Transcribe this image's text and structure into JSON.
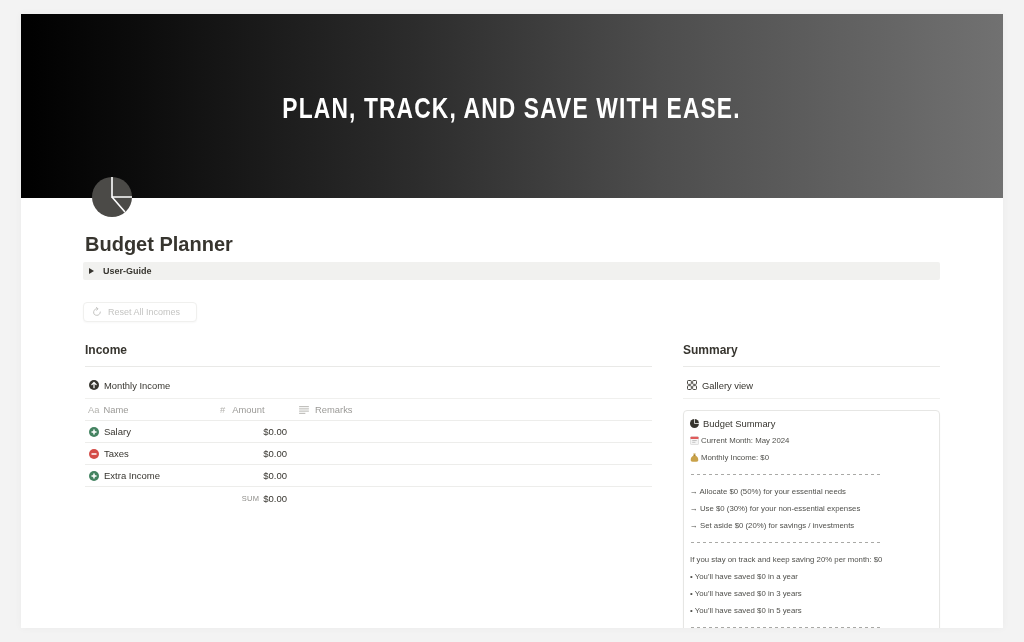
{
  "cover": {
    "headline": "PLAN, TRACK, AND SAVE WITH EASE."
  },
  "page": {
    "title": "Budget Planner"
  },
  "toggle": {
    "label": "User-Guide",
    "expanded": false
  },
  "reset_button": {
    "label": "Reset All Incomes",
    "disabled": true
  },
  "income": {
    "heading": "Income",
    "view_tab": {
      "label": "Monthly Income"
    },
    "table": {
      "columns": [
        {
          "name": "Name",
          "kind": "title",
          "glyph": "Aa"
        },
        {
          "name": "Amount",
          "kind": "number",
          "glyph": "#"
        },
        {
          "name": "Remarks",
          "kind": "text"
        }
      ],
      "rows": [
        {
          "kind": "add",
          "color": "#448361",
          "name": "Salary",
          "amount": "$0.00"
        },
        {
          "kind": "subtract",
          "color": "#d44c47",
          "name": "Taxes",
          "amount": "$0.00"
        },
        {
          "kind": "add",
          "color": "#448361",
          "name": "Extra Income",
          "amount": "$0.00"
        }
      ],
      "footer": {
        "label": "SUM",
        "value": "$0.00"
      }
    }
  },
  "summary": {
    "heading": "Summary",
    "view_tab": {
      "label": "Gallery view"
    },
    "card": {
      "title": "Budget Summary",
      "lines": [
        {
          "kind": "calendar",
          "text": "Current Month: May 2024"
        },
        {
          "kind": "money",
          "text": "Monthly Income: $0"
        },
        {
          "kind": "divider"
        },
        {
          "kind": "text",
          "text": "→ Allocate $0 (50%) for your essential needs"
        },
        {
          "kind": "text",
          "text": "→ Use $0 (30%) for your non-essential expenses"
        },
        {
          "kind": "text",
          "text": "→ Set aside $0 (20%) for savings / investments"
        },
        {
          "kind": "divider"
        },
        {
          "kind": "text",
          "text": "If you stay on track and keep saving 20% per month: $0"
        },
        {
          "kind": "text",
          "text": "• You'll have saved $0 in a year"
        },
        {
          "kind": "text",
          "text": "• You'll have saved $0 in 3 years"
        },
        {
          "kind": "text",
          "text": "• You'll have saved $0 in 5 years"
        },
        {
          "kind": "divider"
        }
      ]
    }
  }
}
